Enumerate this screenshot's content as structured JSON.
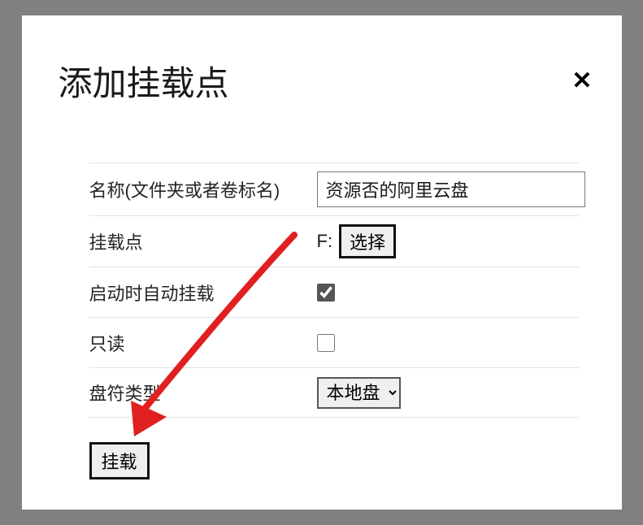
{
  "modal": {
    "title": "添加挂载点",
    "close_label": "✕"
  },
  "form": {
    "name": {
      "label": "名称(文件夹或者卷标名)",
      "value": "资源否的阿里云盘"
    },
    "mountpoint": {
      "label": "挂载点",
      "drive": "F:",
      "select_button": "选择"
    },
    "automount": {
      "label": "启动时自动挂载",
      "checked": true
    },
    "readonly": {
      "label": "只读",
      "checked": false
    },
    "drivetype": {
      "label": "盘符类型",
      "selected": "本地盘",
      "options": [
        "本地盘"
      ]
    }
  },
  "actions": {
    "mount": "挂载"
  },
  "annotation": {
    "color": "#e02020"
  }
}
